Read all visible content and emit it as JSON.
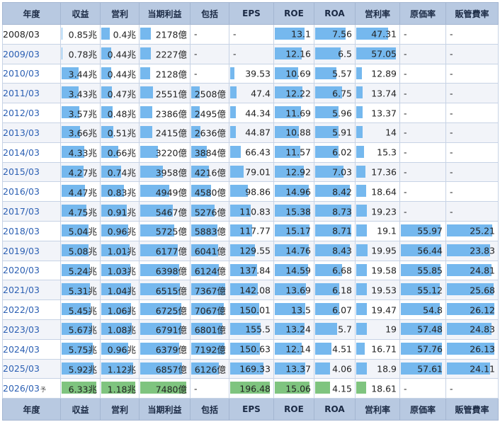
{
  "headers": [
    "年度",
    "収益",
    "営利",
    "当期利益",
    "包括",
    "EPS",
    "ROE",
    "ROA",
    "営利率",
    "原価率",
    "販管費率"
  ],
  "estimate_mark": "予",
  "columns_max": {
    "rev": 6.33,
    "op": 1.18,
    "net": 7480,
    "comp": 7367,
    "eps": 196.48,
    "roe": 15.38,
    "roa": 8.73,
    "opm": 57.05,
    "cost": 57.76,
    "sga": 26.13
  },
  "rows": [
    {
      "year": "2008/03",
      "linked": false,
      "est": false,
      "rev": "0.85兆",
      "op": "0.4兆",
      "net": "2178億",
      "comp": "-",
      "eps": "-",
      "roe": "13.1",
      "roa": "7.56",
      "opm": "47.31",
      "cost": "-",
      "sga": "-"
    },
    {
      "year": "2009/03",
      "linked": true,
      "est": false,
      "rev": "0.78兆",
      "op": "0.44兆",
      "net": "2227億",
      "comp": "-",
      "eps": "-",
      "roe": "12.16",
      "roa": "6.5",
      "opm": "57.05",
      "cost": "-",
      "sga": "-"
    },
    {
      "year": "2010/03",
      "linked": true,
      "est": false,
      "rev": "3.44兆",
      "op": "0.44兆",
      "net": "2128億",
      "comp": "-",
      "eps": "39.53",
      "roe": "10.69",
      "roa": "5.57",
      "opm": "12.89",
      "cost": "-",
      "sga": "-"
    },
    {
      "year": "2011/03",
      "linked": true,
      "est": false,
      "rev": "3.43兆",
      "op": "0.47兆",
      "net": "2551億",
      "comp": "2508億",
      "eps": "47.4",
      "roe": "12.22",
      "roa": "6.75",
      "opm": "13.74",
      "cost": "-",
      "sga": "-"
    },
    {
      "year": "2012/03",
      "linked": true,
      "est": false,
      "rev": "3.57兆",
      "op": "0.48兆",
      "net": "2386億",
      "comp": "2495億",
      "eps": "44.34",
      "roe": "11.69",
      "roa": "5.96",
      "opm": "13.37",
      "cost": "-",
      "sga": "-"
    },
    {
      "year": "2013/03",
      "linked": true,
      "est": false,
      "rev": "3.66兆",
      "op": "0.51兆",
      "net": "2415億",
      "comp": "2636億",
      "eps": "44.87",
      "roe": "10.88",
      "roa": "5.91",
      "opm": "14",
      "cost": "-",
      "sga": "-"
    },
    {
      "year": "2014/03",
      "linked": true,
      "est": false,
      "rev": "4.33兆",
      "op": "0.66兆",
      "net": "3220億",
      "comp": "3884億",
      "eps": "66.43",
      "roe": "11.57",
      "roa": "6.02",
      "opm": "15.3",
      "cost": "-",
      "sga": "-"
    },
    {
      "year": "2015/03",
      "linked": true,
      "est": false,
      "rev": "4.27兆",
      "op": "0.74兆",
      "net": "3958億",
      "comp": "4216億",
      "eps": "79.01",
      "roe": "12.92",
      "roa": "7.03",
      "opm": "17.36",
      "cost": "-",
      "sga": "-"
    },
    {
      "year": "2016/03",
      "linked": true,
      "est": false,
      "rev": "4.47兆",
      "op": "0.83兆",
      "net": "4949億",
      "comp": "4580億",
      "eps": "98.86",
      "roe": "14.96",
      "roa": "8.42",
      "opm": "18.64",
      "cost": "-",
      "sga": "-"
    },
    {
      "year": "2017/03",
      "linked": true,
      "est": false,
      "rev": "4.75兆",
      "op": "0.91兆",
      "net": "5467億",
      "comp": "5276億",
      "eps": "110.83",
      "roe": "15.38",
      "roa": "8.73",
      "opm": "19.23",
      "cost": "-",
      "sga": "-"
    },
    {
      "year": "2018/03",
      "linked": true,
      "est": false,
      "rev": "5.04兆",
      "op": "0.96兆",
      "net": "5725億",
      "comp": "5883億",
      "eps": "117.77",
      "roe": "15.17",
      "roa": "8.71",
      "opm": "19.1",
      "cost": "55.97",
      "sga": "25.21"
    },
    {
      "year": "2019/03",
      "linked": true,
      "est": false,
      "rev": "5.08兆",
      "op": "1.01兆",
      "net": "6177億",
      "comp": "6041億",
      "eps": "129.55",
      "roe": "14.76",
      "roa": "8.43",
      "opm": "19.95",
      "cost": "56.44",
      "sga": "23.83"
    },
    {
      "year": "2020/03",
      "linked": true,
      "est": false,
      "rev": "5.24兆",
      "op": "1.03兆",
      "net": "6398億",
      "comp": "6124億",
      "eps": "137.84",
      "roe": "14.59",
      "roa": "6.68",
      "opm": "19.58",
      "cost": "55.85",
      "sga": "24.81"
    },
    {
      "year": "2021/03",
      "linked": true,
      "est": false,
      "rev": "5.31兆",
      "op": "1.04兆",
      "net": "6515億",
      "comp": "7367億",
      "eps": "142.08",
      "roe": "13.69",
      "roa": "6.18",
      "opm": "19.53",
      "cost": "55.12",
      "sga": "25.68"
    },
    {
      "year": "2022/03",
      "linked": true,
      "est": false,
      "rev": "5.45兆",
      "op": "1.06兆",
      "net": "6725億",
      "comp": "7067億",
      "eps": "150.01",
      "roe": "13.5",
      "roa": "6.07",
      "opm": "19.47",
      "cost": "54.8",
      "sga": "26.12"
    },
    {
      "year": "2023/03",
      "linked": true,
      "est": false,
      "rev": "5.67兆",
      "op": "1.08兆",
      "net": "6791億",
      "comp": "6801億",
      "eps": "155.5",
      "roe": "13.24",
      "roa": "5.7",
      "opm": "19",
      "cost": "57.48",
      "sga": "24.83"
    },
    {
      "year": "2024/03",
      "linked": true,
      "est": false,
      "rev": "5.75兆",
      "op": "0.96兆",
      "net": "6379億",
      "comp": "7192億",
      "eps": "150.63",
      "roe": "12.14",
      "roa": "4.51",
      "opm": "16.71",
      "cost": "57.76",
      "sga": "26.13"
    },
    {
      "year": "2025/03",
      "linked": true,
      "est": false,
      "rev": "5.92兆",
      "op": "1.12兆",
      "net": "6857億",
      "comp": "6126億",
      "eps": "169.33",
      "roe": "13.37",
      "roa": "4.06",
      "opm": "18.9",
      "cost": "57.61",
      "sga": "24.11"
    },
    {
      "year": "2026/03",
      "linked": true,
      "est": true,
      "rev": "6.33兆",
      "op": "1.18兆",
      "net": "7480億",
      "comp": "-",
      "eps": "196.48",
      "roe": "15.06",
      "roa": "4.15",
      "opm": "18.61",
      "cost": "-",
      "sga": "-"
    }
  ],
  "colors": {
    "header_bg": "#b8c9e1",
    "bar_actual": "#75b8ee",
    "bar_estimate": "#7fc47f",
    "link": "#2b5fb3"
  }
}
